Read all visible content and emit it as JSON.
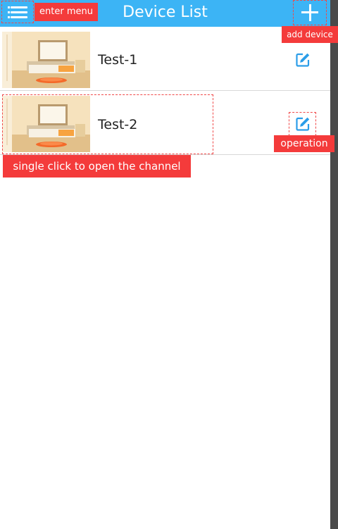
{
  "header": {
    "title": "Device List",
    "menu_icon": "menu-icon",
    "add_icon": "plus-icon",
    "background": "#3cb4f5"
  },
  "devices": [
    {
      "name": "Test-1",
      "thumbnail": "bedroom-photo",
      "action_icon": "edit-icon"
    },
    {
      "name": "Test-2",
      "thumbnail": "bedroom-photo",
      "action_icon": "edit-icon"
    }
  ],
  "annotations": {
    "menu": "enter menu",
    "add": "add device",
    "operation": "operation",
    "open_channel": "single click to open the channel"
  },
  "colors": {
    "accent": "#3cb4f5",
    "annotation": "#f43b3b",
    "divider": "#d8d8d8"
  }
}
